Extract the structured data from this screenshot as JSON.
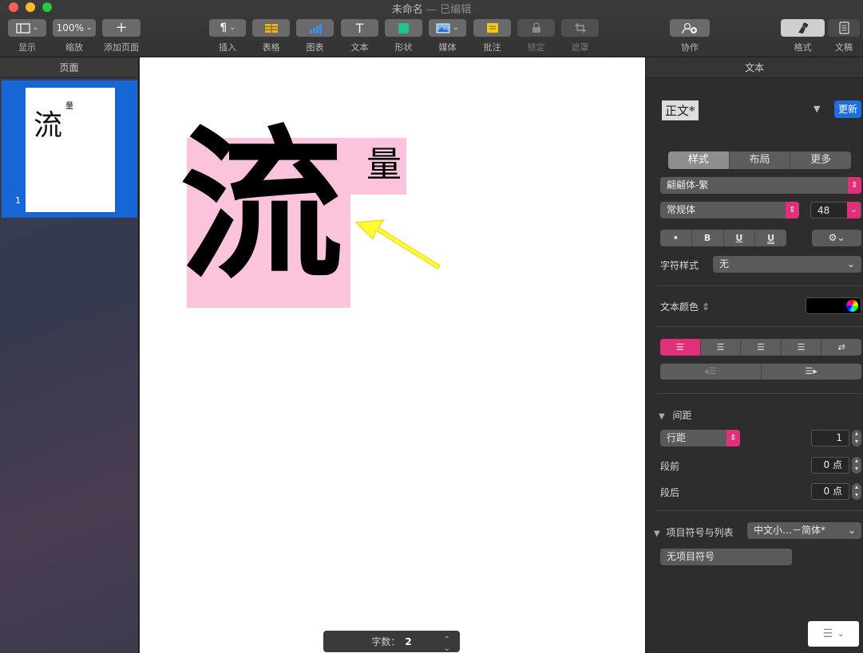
{
  "window": {
    "title": "未命名",
    "status": "— 已编辑"
  },
  "toolbar": {
    "view": "显示",
    "zoom_value": "100%",
    "zoom": "缩放",
    "add_page": "添加页面",
    "insert": "插入",
    "table": "表格",
    "chart": "图表",
    "text": "文本",
    "shape": "形状",
    "media": "媒体",
    "comment": "批注",
    "lock": "锁定",
    "mask": "遮罩",
    "collaborate": "协作",
    "format": "格式",
    "document": "文稿"
  },
  "sidebar": {
    "header": "页面",
    "page_number": "1"
  },
  "canvas": {
    "big_char": "流",
    "small_char": "量"
  },
  "status_bar": {
    "label": "字数：",
    "count": "2"
  },
  "panel": {
    "title": "文本",
    "paragraph_style": "正文*",
    "update": "更新",
    "tabs": [
      "样式",
      "布局",
      "更多"
    ],
    "font_family": "翩翩体-繁",
    "font_weight": "常规体",
    "font_size": "48",
    "format_buttons": [
      "•",
      "B",
      "U",
      "U"
    ],
    "char_style_label": "字符样式",
    "char_style_value": "无",
    "text_color_label": "文本颜色",
    "spacing_header": "间距",
    "line_spacing_label": "行距",
    "line_spacing_value": "1",
    "before_label": "段前",
    "before_value": "0 点",
    "after_label": "段后",
    "after_value": "0 点",
    "bullets_label": "项目符号与列表",
    "bullets_value": "中文小…－简体*",
    "no_bullets": "无项目符号"
  }
}
